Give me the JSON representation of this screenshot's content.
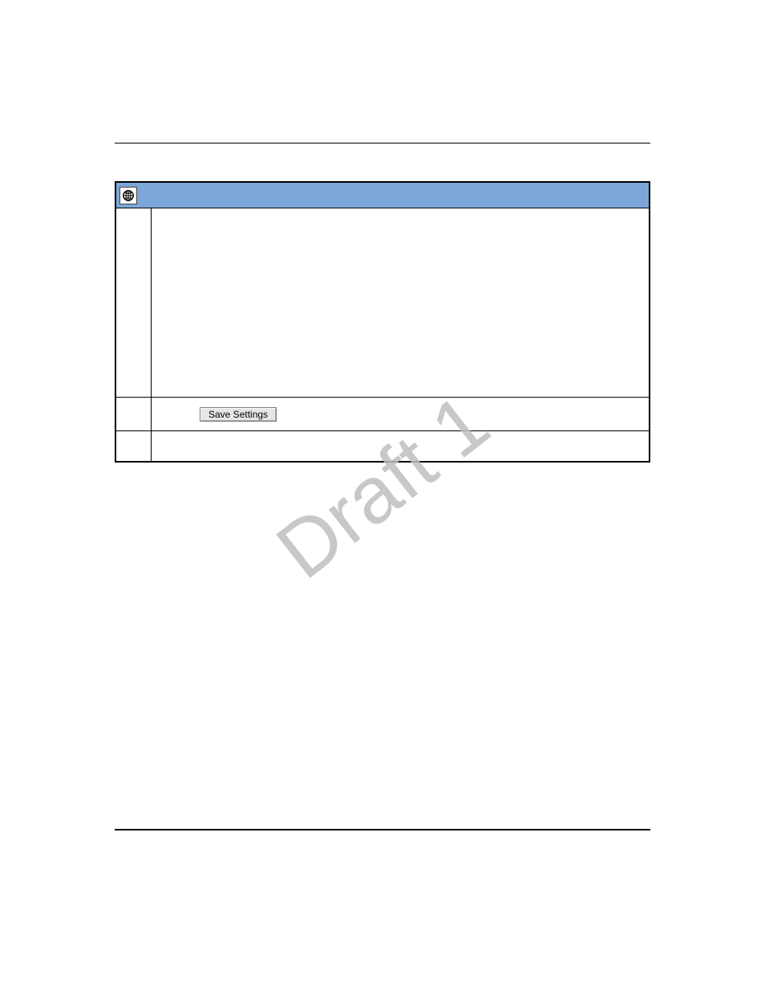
{
  "window": {
    "titlebar": {
      "icon_name": "globe-icon"
    },
    "buttons": {
      "save_label": "Save Settings"
    }
  },
  "watermark": {
    "text": "Draft 1"
  }
}
